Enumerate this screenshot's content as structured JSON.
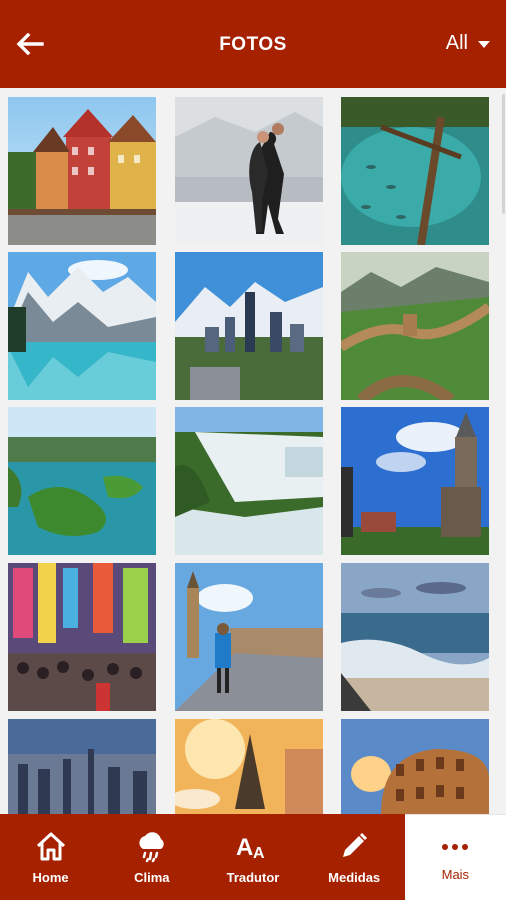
{
  "app_bar": {
    "title": "FOTOS",
    "filter_label": "All"
  },
  "photos": [
    "Colorful half-timbered houses",
    "Couple dancing tango",
    "Turquoise lake with fish",
    "Mountain lake with reflection",
    "City skyline with mountains",
    "Great Wall of China",
    "Green islands in lake",
    "Waterfalls",
    "Wooden church",
    "Busy street with signs",
    "Big Ben street",
    "Seaside waves",
    "City skyline at dusk",
    "Eiffel Tower with photographer",
    "Colosseum at sunset"
  ],
  "bottom_nav": {
    "items": [
      {
        "label": "Home",
        "icon": "home-icon"
      },
      {
        "label": "Clima",
        "icon": "cloud-rain-icon"
      },
      {
        "label": "Tradutor",
        "icon": "translate-icon"
      },
      {
        "label": "Medidas",
        "icon": "pencil-icon"
      },
      {
        "label": "Mais",
        "icon": "more-dots-icon"
      }
    ],
    "active_index": 4
  },
  "colors": {
    "primary": "#a52100",
    "background": "#f2f2f2",
    "active_tab_bg": "#ffffff"
  }
}
